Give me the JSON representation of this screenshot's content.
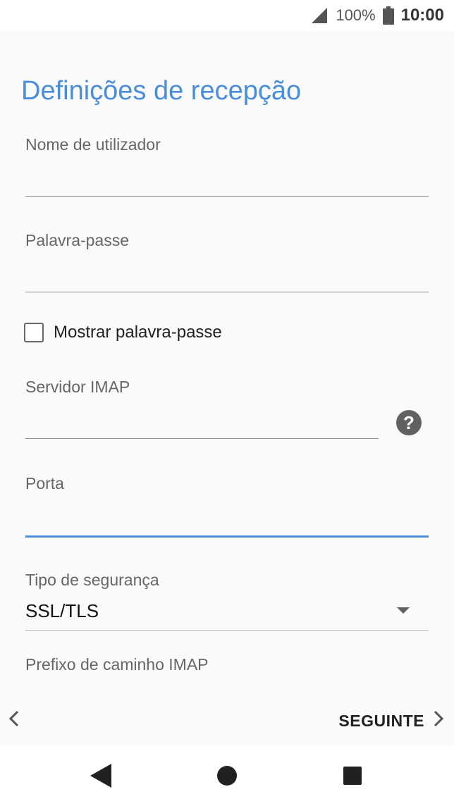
{
  "status_bar": {
    "battery_percent": "100%",
    "time": "10:00"
  },
  "page": {
    "title": "Definições de recepção"
  },
  "form": {
    "username": {
      "label": "Nome de utilizador",
      "value": ""
    },
    "password": {
      "label": "Palavra-passe",
      "value": ""
    },
    "show_password": {
      "label": "Mostrar palavra-passe",
      "checked": false
    },
    "imap_server": {
      "label": "Servidor IMAP",
      "value": ""
    },
    "port": {
      "label": "Porta",
      "value": ""
    },
    "security_type": {
      "label": "Tipo de segurança",
      "value": "SSL/TLS"
    },
    "imap_path_prefix": {
      "label": "Prefixo de caminho IMAP"
    }
  },
  "footer": {
    "next_label": "SEGUINTE"
  },
  "colors": {
    "accent": "#4a8ddb",
    "background": "#fafafa"
  },
  "icons": {
    "signal": "signal-icon",
    "battery": "battery-icon",
    "help": "help-icon",
    "dropdown": "dropdown-arrow-icon",
    "back": "chevron-left-icon",
    "next": "chevron-right-icon"
  }
}
